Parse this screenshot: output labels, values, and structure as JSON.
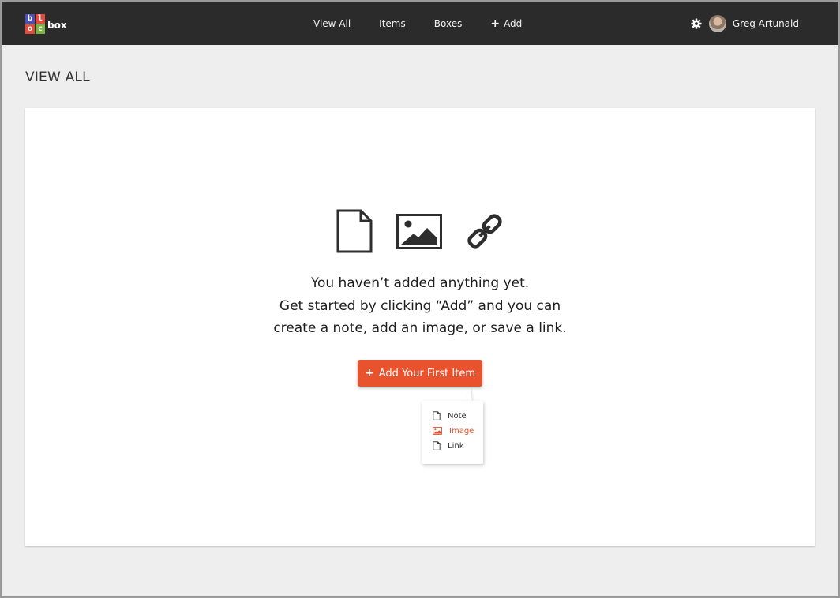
{
  "brand": {
    "logo_letters": [
      "b",
      "l",
      "o",
      "c"
    ],
    "logo_colors": [
      "#4a4fb5",
      "#e14b3b",
      "#e14b3b",
      "#7bb342"
    ],
    "logo_word": "box"
  },
  "nav": {
    "links": [
      {
        "label": "View All"
      },
      {
        "label": "Items"
      },
      {
        "label": "Boxes"
      },
      {
        "label": "Add",
        "icon": "plus-icon"
      }
    ],
    "settings_icon": "gear-icon",
    "user_name": "Greg Artunald"
  },
  "page": {
    "title": "VIEW ALL"
  },
  "empty_state": {
    "icons": [
      "document-icon",
      "image-icon",
      "link-icon"
    ],
    "lines": [
      "You haven’t added anything yet.",
      "Get started by clicking “Add” and you can",
      "create a note, add an image, or save a link."
    ],
    "button_label": "Add Your First Item",
    "menu": [
      {
        "label": "Note",
        "icon": "document-icon",
        "active": false
      },
      {
        "label": "Image",
        "icon": "image-icon",
        "active": true
      },
      {
        "label": "Link",
        "icon": "document-icon",
        "active": false
      }
    ]
  },
  "colors": {
    "navbar": "#2b2b2c",
    "accent": "#e8522c",
    "background": "#eeeeee"
  }
}
